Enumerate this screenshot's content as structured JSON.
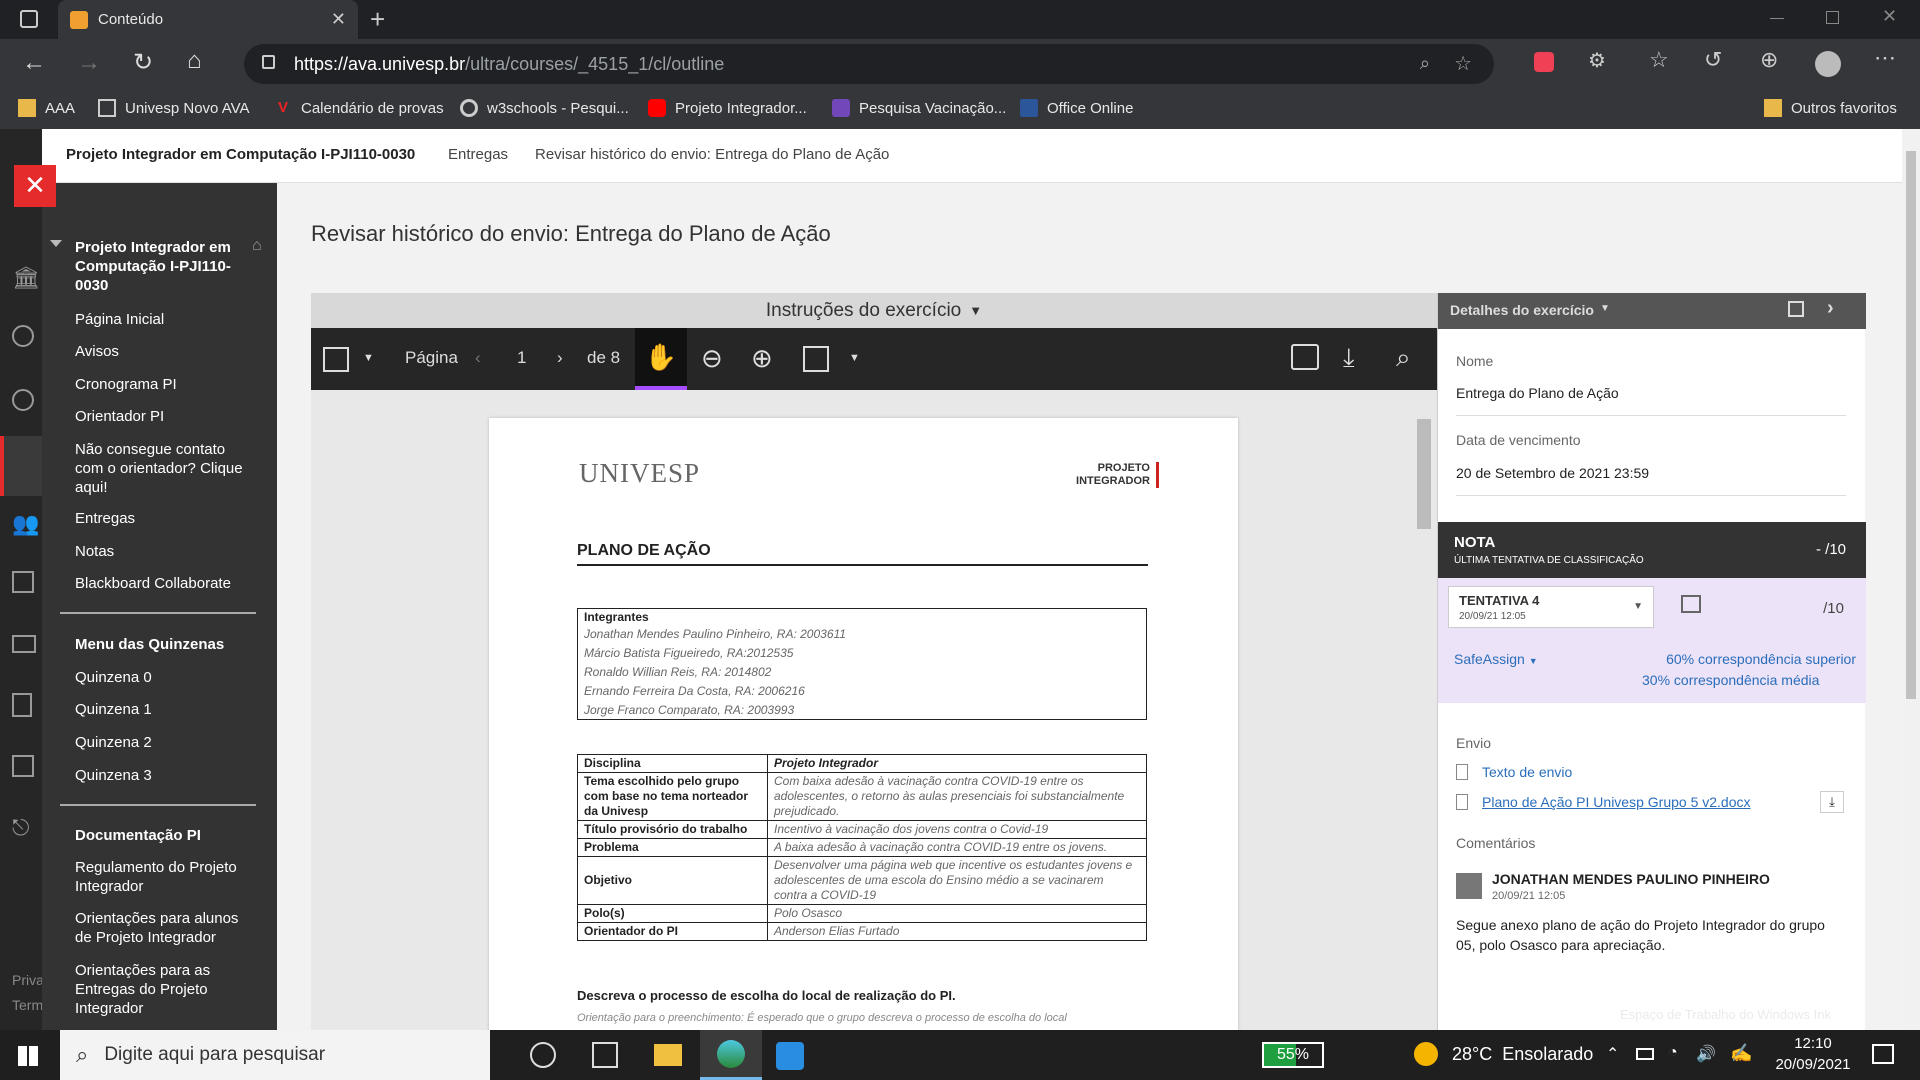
{
  "browser": {
    "tab_title": "Conteúdo",
    "url_main": "https://ava.univesp.br",
    "url_path": "/ultra/courses/_4515_1/cl/outline",
    "bookmarks": [
      "AAA",
      "Univesp Novo AVA",
      "Calendário de provas",
      "w3schools - Pesqui...",
      "Projeto Integrador...",
      "Pesquisa Vacinação...",
      "Office Online"
    ],
    "other_favorites": "Outros favoritos"
  },
  "breadcrumb": {
    "course": "Projeto Integrador em Computação I-PJI110-0030",
    "item1": "Entregas",
    "item2": "Revisar histórico do envio: Entrega do Plano de Ação"
  },
  "sidebar": {
    "course_title": "Projeto Integrador em Computação I-PJI110-0030",
    "items": [
      "Página Inicial",
      "Avisos",
      "Cronograma PI",
      "Orientador PI",
      "Não consegue contato com o orientador? Clique aqui!",
      "Entregas",
      "Notas",
      "Blackboard Collaborate"
    ],
    "section2_title": "Menu das Quinzenas",
    "section2_items": [
      "Quinzena 0",
      "Quinzena 1",
      "Quinzena 2",
      "Quinzena 3"
    ],
    "section3_title": "Documentação PI",
    "section3_items": [
      "Regulamento do Projeto Integrador",
      "Orientações para alunos de Projeto Integrador",
      "Orientações para as Entregas do Projeto Integrador"
    ],
    "footer_partial": [
      "Priva",
      "Term"
    ]
  },
  "main": {
    "title": "Revisar histórico do envio: Entrega do Plano de Ação",
    "instructions_label": "Instruções do exercício"
  },
  "pdf_toolbar": {
    "page_label": "Página",
    "page_current": "1",
    "page_total": "de 8"
  },
  "pdf": {
    "logo_text": "UNIVESP",
    "logo_right_1": "PROJETO",
    "logo_right_2": "INTEGRADOR",
    "heading": "PLANO DE AÇÃO",
    "integrantes_label": "Integrantes",
    "integrantes": [
      "Jonathan Mendes Paulino Pinheiro, RA:  2003611",
      "Márcio Batista Figueiredo, RA:2012535",
      "Ronaldo Willian Reis, RA:  2014802",
      "Ernando Ferreira Da Costa, RA: 2006216",
      "Jorge Franco Comparato, RA: 2003993"
    ],
    "rows": [
      {
        "k": "Disciplina",
        "v": "Projeto Integrador"
      },
      {
        "k": "Tema escolhido pelo grupo com base no tema norteador da Univesp",
        "v": "Com baixa adesão à vacinação contra COVID-19 entre os adolescentes, o retorno às aulas presenciais foi substancialmente prejudicado."
      },
      {
        "k": "Título provisório do trabalho",
        "v": "Incentivo à vacinação dos jovens contra o Covid-19"
      },
      {
        "k": "Problema",
        "v": "A baixa adesão à vacinação contra COVID-19 entre os jovens."
      },
      {
        "k": "Objetivo",
        "v": "Desenvolver uma página web que incentive os estudantes jovens e adolescentes de uma escola do Ensino médio a se vacinarem contra a COVID-19"
      },
      {
        "k": "Polo(s)",
        "v": "Polo Osasco"
      },
      {
        "k": "Orientador do PI",
        "v": "Anderson Elias Furtado"
      }
    ],
    "section_text": "Descreva o processo de escolha do local de realização do PI.",
    "section_sub": "Orientação para o preenchimento: É esperado que o grupo descreva o processo de escolha do local"
  },
  "details": {
    "header": "Detalhes do exercício",
    "name_label": "Nome",
    "name_value": "Entrega do Plano de Ação",
    "due_label": "Data de vencimento",
    "due_value": "20 de Setembro de 2021 23:59",
    "grade_title": "NOTA",
    "grade_sub": "ÚLTIMA TENTATIVA DE CLASSIFICAÇÃO",
    "grade_value": "- /10",
    "attempt_title": "TENTATIVA 4",
    "attempt_date": "20/09/21 12:05",
    "attempt_grade": "/10",
    "safeassign": "SafeAssign",
    "match1": "60% correspondência superior",
    "match2": "30% correspondência média",
    "envio_label": "Envio",
    "text_link": "Texto de envio",
    "file_link": "Plano de Ação PI Univesp Grupo 5 v2.docx",
    "comments_label": "Comentários",
    "commenter": "JONATHAN MENDES PAULINO PINHEIRO",
    "comment_date": "20/09/21 12:05",
    "comment_text": "Segue anexo plano de ação do Projeto Integrador do grupo 05, polo Osasco para apreciação.",
    "watermark": "Espaço de Trabalho do Windows Ink"
  },
  "taskbar": {
    "search_placeholder": "Digite aqui para pesquisar",
    "battery": "55%",
    "weather": "28°C  Ensolarado",
    "time": "12:10",
    "date": "20/09/2021"
  },
  "colors": {
    "accent_purple": "#a64dff",
    "link_blue": "#2a6ebb",
    "close_red": "#e52b2b"
  }
}
